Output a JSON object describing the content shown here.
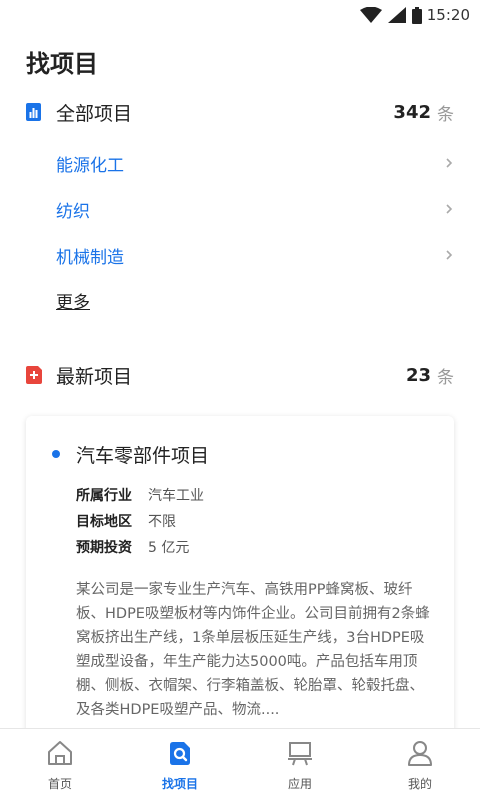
{
  "status_bar": {
    "time": "15:20"
  },
  "page": {
    "title": "找项目"
  },
  "all_projects": {
    "title": "全部项目",
    "count": "342",
    "unit": "条",
    "categories": [
      {
        "label": "能源化工"
      },
      {
        "label": "纺织"
      },
      {
        "label": "机械制造"
      }
    ],
    "more_label": "更多"
  },
  "new_projects": {
    "title": "最新项目",
    "count": "23",
    "unit": "条",
    "items": [
      {
        "title": "汽车零部件项目",
        "meta": [
          {
            "key": "所属行业",
            "value": "汽车工业"
          },
          {
            "key": "目标地区",
            "value": "不限"
          },
          {
            "key": "预期投资",
            "value": "5 亿元"
          }
        ],
        "description": "某公司是一家专业生产汽车、高铁用PP蜂窝板、玻纤板、HDPE吸塑板材等内饰件企业。公司目前拥有2条蜂窝板挤出生产线，1条单层板压延生产线，3台HDPE吸塑成型设备，年生产能力达5000吨。产品包括车用顶棚、侧板、衣帽架、行李箱盖板、轮胎罩、轮毂托盘、及各类HDPE吸塑产品、物流...."
      }
    ]
  },
  "tab_bar": {
    "tabs": [
      {
        "label": "首页",
        "icon": "home-icon"
      },
      {
        "label": "找项目",
        "icon": "search-project-icon"
      },
      {
        "label": "应用",
        "icon": "apps-icon"
      },
      {
        "label": "我的",
        "icon": "user-icon"
      }
    ],
    "active_index": 1
  },
  "colors": {
    "accent": "#1a73e8",
    "new_icon": "#e8453c"
  }
}
